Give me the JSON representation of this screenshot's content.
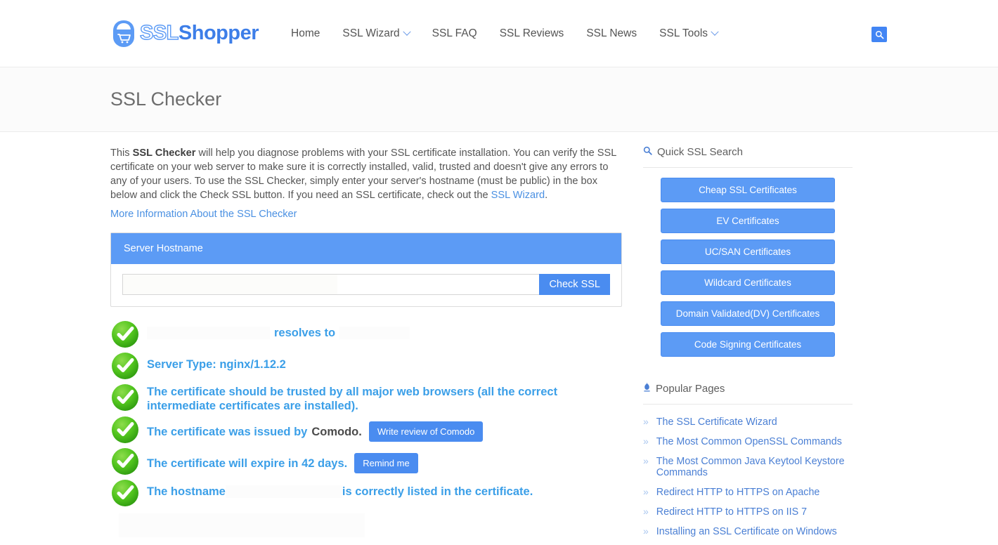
{
  "header": {
    "logo": {
      "part1": "SSL",
      "part2": "Shopper",
      "icon": "ssl-shopper-cart-logo"
    },
    "nav": [
      {
        "label": "Home",
        "has_dropdown": false
      },
      {
        "label": "SSL Wizard",
        "has_dropdown": true
      },
      {
        "label": "SSL FAQ",
        "has_dropdown": false
      },
      {
        "label": "SSL Reviews",
        "has_dropdown": false
      },
      {
        "label": "SSL News",
        "has_dropdown": false
      },
      {
        "label": "SSL Tools",
        "has_dropdown": true
      }
    ],
    "search_icon": "search-icon"
  },
  "page": {
    "title": "SSL Checker"
  },
  "intro": {
    "p1_a": "This ",
    "p1_bold": "SSL Checker",
    "p1_b": " will help you diagnose problems with your SSL certificate installation. You can verify the SSL certificate on your web server to make sure it is correctly installed, valid, trusted and doesn't give any errors to any of your users. To use the SSL Checker, simply enter your server's hostname (must be public) in the box below and click the Check SSL button. If you need an SSL certificate, check out the ",
    "p1_link": "SSL Wizard",
    "p1_c": ".",
    "more_info_link": "More Information About the SSL Checker"
  },
  "checker": {
    "panel_title": "Server Hostname",
    "input_value": "",
    "input_placeholder": "",
    "submit_label": "Check SSL"
  },
  "results": [
    {
      "id": "dns-resolves",
      "status": "pass",
      "pre_redacted": true,
      "text": "resolves to",
      "post_redacted": true
    },
    {
      "id": "server-type",
      "status": "pass",
      "text": "Server Type: nginx/1.12.2"
    },
    {
      "id": "trust-chain",
      "status": "pass",
      "text": "The certificate should be trusted by all major web browsers (all the correct intermediate certificates are installed)."
    },
    {
      "id": "issuer",
      "status": "pass",
      "text": "The certificate was issued by",
      "issuer": "Comodo.",
      "button": "Write review of Comodo"
    },
    {
      "id": "expiry",
      "status": "pass",
      "text": "The certificate will expire in 42 days.",
      "button": "Remind me"
    },
    {
      "id": "hostname-match",
      "status": "pass",
      "text_before": "The hostname",
      "text_after": "is correctly listed in the certificate.",
      "mid_redacted": true
    }
  ],
  "sidebar": {
    "quick_search": {
      "icon": "search-icon",
      "title": "Quick SSL Search"
    },
    "quick_search_buttons": [
      "Cheap SSL Certificates",
      "EV Certificates",
      "UC/SAN Certificates",
      "Wildcard Certificates",
      "Domain Validated(DV) Certificates",
      "Code Signing Certificates"
    ],
    "popular": {
      "icon": "flame-icon",
      "title": "Popular Pages"
    },
    "popular_pages": [
      "The SSL Certificate Wizard",
      "The Most Common OpenSSL Commands",
      "The Most Common Java Keytool Keystore Commands",
      "Redirect HTTP to HTTPS on Apache",
      "Redirect HTTP to HTTPS on IIS 7",
      "Installing an SSL Certificate on Windows"
    ]
  },
  "colors": {
    "brand_blue": "#4a8cf0",
    "panel_blue": "#5c9bf5",
    "link_blue": "#4a90e2",
    "result_blue": "#3b9fe8",
    "pass_green": "#3cb521"
  }
}
